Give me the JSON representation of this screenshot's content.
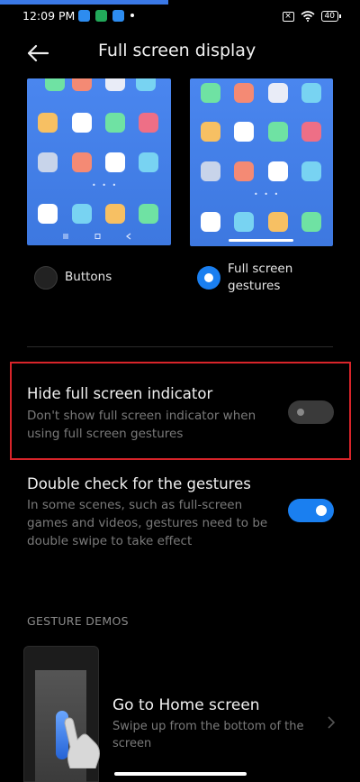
{
  "status_bar": {
    "time": "12:09 PM",
    "battery": "40",
    "icons": [
      "app-notification-icon",
      "app-notification-icon",
      "app-notification-icon",
      "sim-icon",
      "wifi-icon",
      "battery-icon"
    ]
  },
  "header": {
    "title": "Full screen display",
    "back_icon": "back-arrow-icon"
  },
  "navigation_options": [
    {
      "label": "Buttons",
      "selected": false
    },
    {
      "label": "Full screen gestures",
      "selected": true
    }
  ],
  "settings": [
    {
      "title": "Hide full screen indicator",
      "description": "Don't show full screen indicator when using full screen gestures",
      "enabled": false
    },
    {
      "title": "Double check for the gestures",
      "description": "In some scenes, such as full-screen games and videos, gestures need to be double swipe to take effect",
      "enabled": true
    }
  ],
  "gesture_demos": {
    "section_label": "GESTURE DEMOS",
    "items": [
      {
        "title": "Go to Home screen",
        "description": "Swipe up from the bottom of the screen"
      }
    ]
  },
  "colors": {
    "accent": "#1a7ff0",
    "highlight_border": "#d8242a",
    "background": "#000000"
  }
}
